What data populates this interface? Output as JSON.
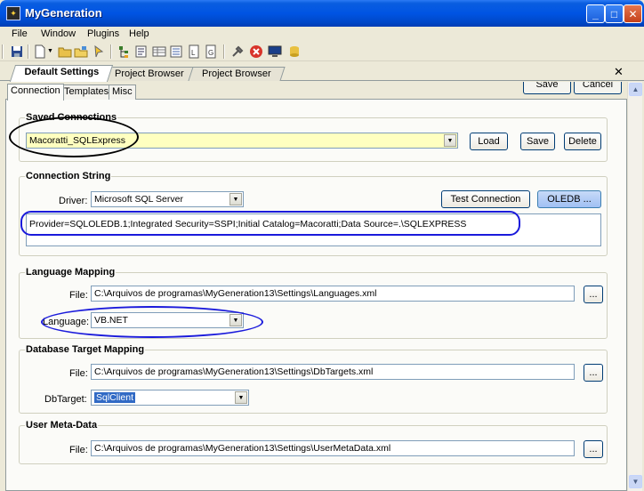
{
  "app": {
    "title": "MyGeneration"
  },
  "menu": [
    "File",
    "Window",
    "Plugins",
    "Help"
  ],
  "doc_tabs": [
    "Default Settings",
    "Project Browser",
    "Project Browser"
  ],
  "inner_tabs": [
    "Connection",
    "Templates",
    "Misc"
  ],
  "top_buttons": [
    "Save",
    "Cancel"
  ],
  "saved_connections": {
    "label": "Saved Connections",
    "value": "Macoratti_SQLExpress",
    "load": "Load",
    "save": "Save",
    "delete": "Delete"
  },
  "connection_string": {
    "label": "Connection String",
    "driver_label": "Driver:",
    "driver_value": "Microsoft SQL Server",
    "test_button": "Test Connection",
    "oledb_button": "OLEDB ...",
    "value": "Provider=SQLOLEDB.1;Integrated Security=SSPI;Initial Catalog=Macoratti;Data Source=.\\SQLEXPRESS"
  },
  "language_mapping": {
    "label": "Language Mapping",
    "file_label": "File:",
    "file_value": "C:\\Arquivos de programas\\MyGeneration13\\Settings\\Languages.xml",
    "browse": "...",
    "language_label": "Language:",
    "language_value": "VB.NET"
  },
  "db_target_mapping": {
    "label": "Database Target Mapping",
    "file_label": "File:",
    "file_value": "C:\\Arquivos de programas\\MyGeneration13\\Settings\\DbTargets.xml",
    "browse": "...",
    "dbtarget_label": "DbTarget:",
    "dbtarget_value": "SqlClient"
  },
  "user_meta_data": {
    "label": "User Meta-Data",
    "file_label": "File:",
    "file_value": "C:\\Arquivos de programas\\MyGeneration13\\Settings\\UserMetaData.xml",
    "browse": "..."
  },
  "colors": {
    "annotation_black": "#000000",
    "annotation_blue": "#1a1adb",
    "highlight_input": "#ffffc0"
  }
}
